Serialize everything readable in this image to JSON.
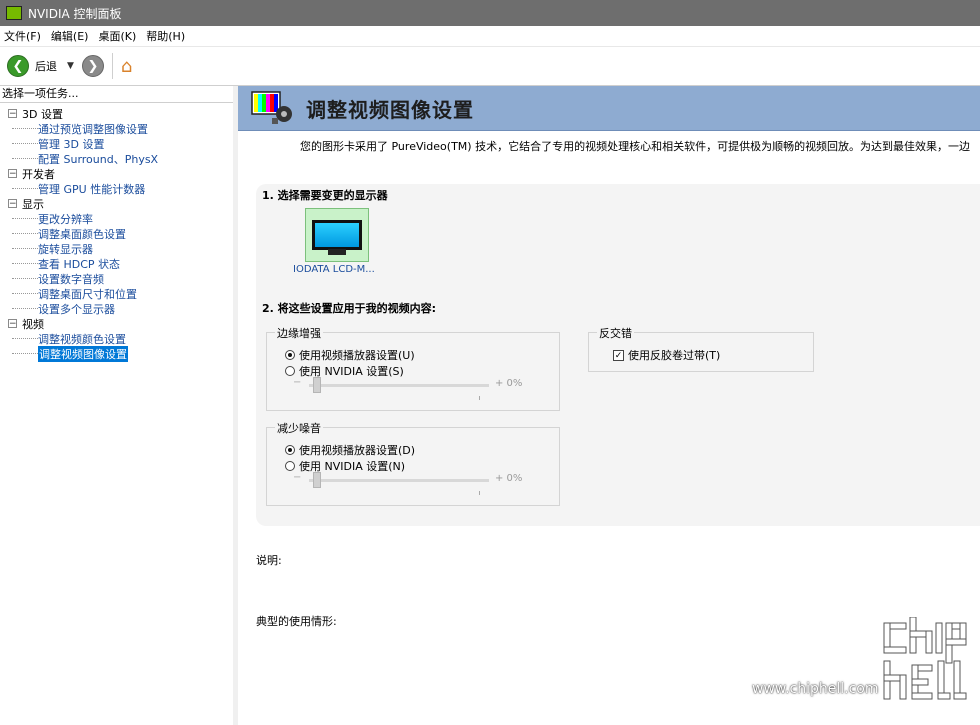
{
  "window": {
    "title": "NVIDIA 控制面板"
  },
  "menu": [
    "文件(F)",
    "编辑(E)",
    "桌面(K)",
    "帮助(H)"
  ],
  "toolbar": {
    "back_label": "后退"
  },
  "left": {
    "task_heading": "选择一项任务...",
    "tree": [
      {
        "label": "3D 设置",
        "items": [
          "通过预览调整图像设置",
          "管理 3D 设置",
          "配置 Surround、PhysX"
        ]
      },
      {
        "label": "开发者",
        "items": [
          "管理 GPU 性能计数器"
        ]
      },
      {
        "label": "显示",
        "items": [
          "更改分辨率",
          "调整桌面颜色设置",
          "旋转显示器",
          "查看 HDCP 状态",
          "设置数字音频",
          "调整桌面尺寸和位置",
          "设置多个显示器"
        ]
      },
      {
        "label": "视频",
        "items": [
          "调整视频颜色设置",
          "调整视频图像设置"
        ]
      }
    ],
    "selected_item": "调整视频图像设置"
  },
  "main": {
    "title": "调整视频图像设置",
    "intro": "您的图形卡采用了 PureVideo(TM) 技术，它结合了专用的视频处理核心和相关软件，可提供极为顺畅的视频回放。为达到最佳效果，一边",
    "step1": "1. 选择需要变更的显示器",
    "monitor_label": "IODATA LCD-M...",
    "step2": "2. 将这些设置应用于我的视频内容:",
    "edge": {
      "label": "边缘增强",
      "opt1": "使用视频播放器设置(U)",
      "opt2": "使用 NVIDIA 设置(S)",
      "selected": 1,
      "slider_minus": "−",
      "slider_value": "+ 0%"
    },
    "noise": {
      "label": "减少噪音",
      "opt1": "使用视频播放器设置(D)",
      "opt2": "使用 NVIDIA 设置(N)",
      "selected": 1,
      "slider_minus": "−",
      "slider_value": "+ 0%"
    },
    "deinterlace": {
      "label": "反交错",
      "checkbox_label": "使用反胶卷过带(T)",
      "checked": true
    },
    "description_label": "说明:",
    "usage_label": "典型的使用情形:"
  },
  "watermark": {
    "url": "www.chiphell.com"
  }
}
